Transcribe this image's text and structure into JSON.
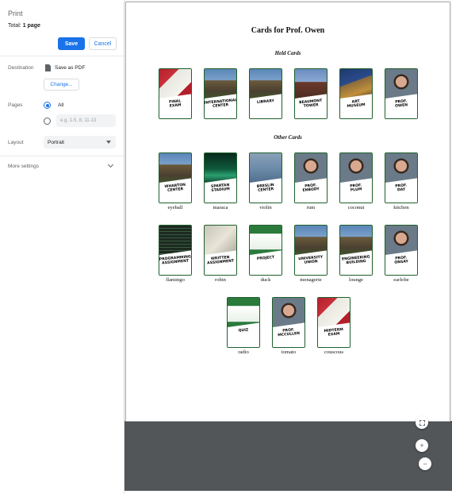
{
  "panel": {
    "title": "Print",
    "total_label": "Total: ",
    "total_value": "1 page",
    "save_label": "Save",
    "cancel_label": "Cancel",
    "destination_label": "Destination",
    "destination_value": "Save as PDF",
    "change_label": "Change...",
    "pages_label": "Pages",
    "pages_all": "All",
    "pages_range_placeholder": "e.g. 1-5, 8, 11-13",
    "layout_label": "Layout",
    "layout_value": "Portrait",
    "more_settings_label": "More settings"
  },
  "document": {
    "title": "Cards for Prof. Owen",
    "held_heading": "Held Cards",
    "other_heading": "Other Cards",
    "held_cards": [
      {
        "label": [
          "FINAL",
          "EXAM"
        ],
        "image": "whiteboard-sketch"
      },
      {
        "label": [
          "INTERNATIONAL",
          "CENTER"
        ],
        "image": "building-photo"
      },
      {
        "label": [
          "LIBRARY"
        ],
        "image": "building-photo"
      },
      {
        "label": [
          "BEAUMONT",
          "TOWER"
        ],
        "image": "tower-photo"
      },
      {
        "label": [
          "ART",
          "MUSEUM"
        ],
        "image": "museum-photo"
      },
      {
        "label": [
          "PROF.",
          "OWEN"
        ],
        "image": "portrait-photo"
      }
    ],
    "other_cards": [
      {
        "label": [
          "WHARTON",
          "CENTER"
        ],
        "word": "eyeball",
        "image": "building-photo"
      },
      {
        "label": [
          "SPARTAN",
          "STADIUM"
        ],
        "word": "maraca",
        "image": "stadium-photo"
      },
      {
        "label": [
          "BRESLIN",
          "CENTER"
        ],
        "word": "violin",
        "image": "arena-photo"
      },
      {
        "label": [
          "PROF.",
          "ENBODY"
        ],
        "word": "rum",
        "image": "portrait-photo"
      },
      {
        "label": [
          "PROF.",
          "PLUM"
        ],
        "word": "coconut",
        "image": "portrait-photo"
      },
      {
        "label": [
          "PROF.",
          "DAY"
        ],
        "word": "kitchen",
        "image": "portrait-photo"
      },
      {
        "label": [
          "PROGRAMMING",
          "ASSIGNMENT"
        ],
        "word": "flamingo",
        "image": "code-screenshot"
      },
      {
        "label": [
          "WRITTEN",
          "ASSIGNMENT"
        ],
        "word": "robin",
        "image": "paper-photo"
      },
      {
        "label": [
          "PROJECT"
        ],
        "word": "duck",
        "image": "screen-photo"
      },
      {
        "label": [
          "UNIVERSITY",
          "UNION"
        ],
        "word": "menagerie",
        "image": "building-photo"
      },
      {
        "label": [
          "ENGINEERING",
          "BUILDING"
        ],
        "word": "lounge",
        "image": "building-photo"
      },
      {
        "label": [
          "PROF.",
          "ONSAY"
        ],
        "word": "earlobe",
        "image": "portrait-photo"
      },
      {
        "label": [
          "QUIZ"
        ],
        "word": "radio",
        "image": "screen-photo"
      },
      {
        "label": [
          "PROF.",
          "MCCULLEN"
        ],
        "word": "tomato",
        "image": "portrait-photo"
      },
      {
        "label": [
          "MIDTERM",
          "EXAM"
        ],
        "word": "couscous",
        "image": "whiteboard-sketch"
      }
    ]
  },
  "colors": {
    "accent": "#1a73e8",
    "card_border": "#1f5f2c",
    "viewer_gray": "#525659"
  },
  "zoom_controls": {
    "fit_icon": "fit-to-page-icon",
    "zoom_in_symbol": "+",
    "zoom_out_symbol": "−"
  }
}
